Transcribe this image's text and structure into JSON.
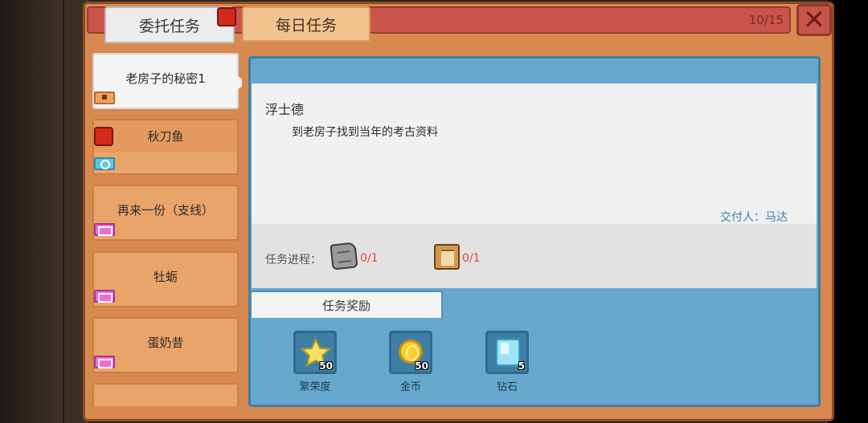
{
  "header": {
    "tabs": [
      {
        "label": "委托任务",
        "active": true,
        "has_alert": true
      },
      {
        "label": "每日任务",
        "active": false
      }
    ],
    "counter": "10/15",
    "close_symbol": "✕"
  },
  "quests": [
    {
      "label": "老房子的秘密1",
      "active": true,
      "tag": "flag-icon"
    },
    {
      "label": "秋刀鱼",
      "active": false,
      "tag": "clock-icon",
      "has_alert": true
    },
    {
      "label": "再来一份（支线）",
      "active": false,
      "tag": "gift-icon"
    },
    {
      "label": "牡蛎",
      "active": false,
      "tag": "gift-icon"
    },
    {
      "label": "蛋奶昔",
      "active": false,
      "tag": "gift-icon"
    }
  ],
  "detail": {
    "npc_name": "浮士德",
    "description": "到老房子找到当年的考古资料",
    "giver": "交付人：马达",
    "progress_label": "任务进程：",
    "progress_items": [
      {
        "icon": "stone-tablet-icon",
        "value": "0/1"
      },
      {
        "icon": "book-icon",
        "value": "0/1"
      }
    ]
  },
  "rewards": {
    "tab_label": "任务奖励",
    "items": [
      {
        "icon": "star-icon",
        "name": "繁荣度",
        "qty": "50"
      },
      {
        "icon": "coin-icon",
        "name": "金币",
        "qty": "50"
      },
      {
        "icon": "diamond-icon",
        "name": "钻石",
        "qty": "5"
      }
    ]
  },
  "colors": {
    "panel": "#d8894f",
    "topbar": "#c9544a",
    "content": "#65a8cc",
    "alert": "#d42a1d"
  }
}
